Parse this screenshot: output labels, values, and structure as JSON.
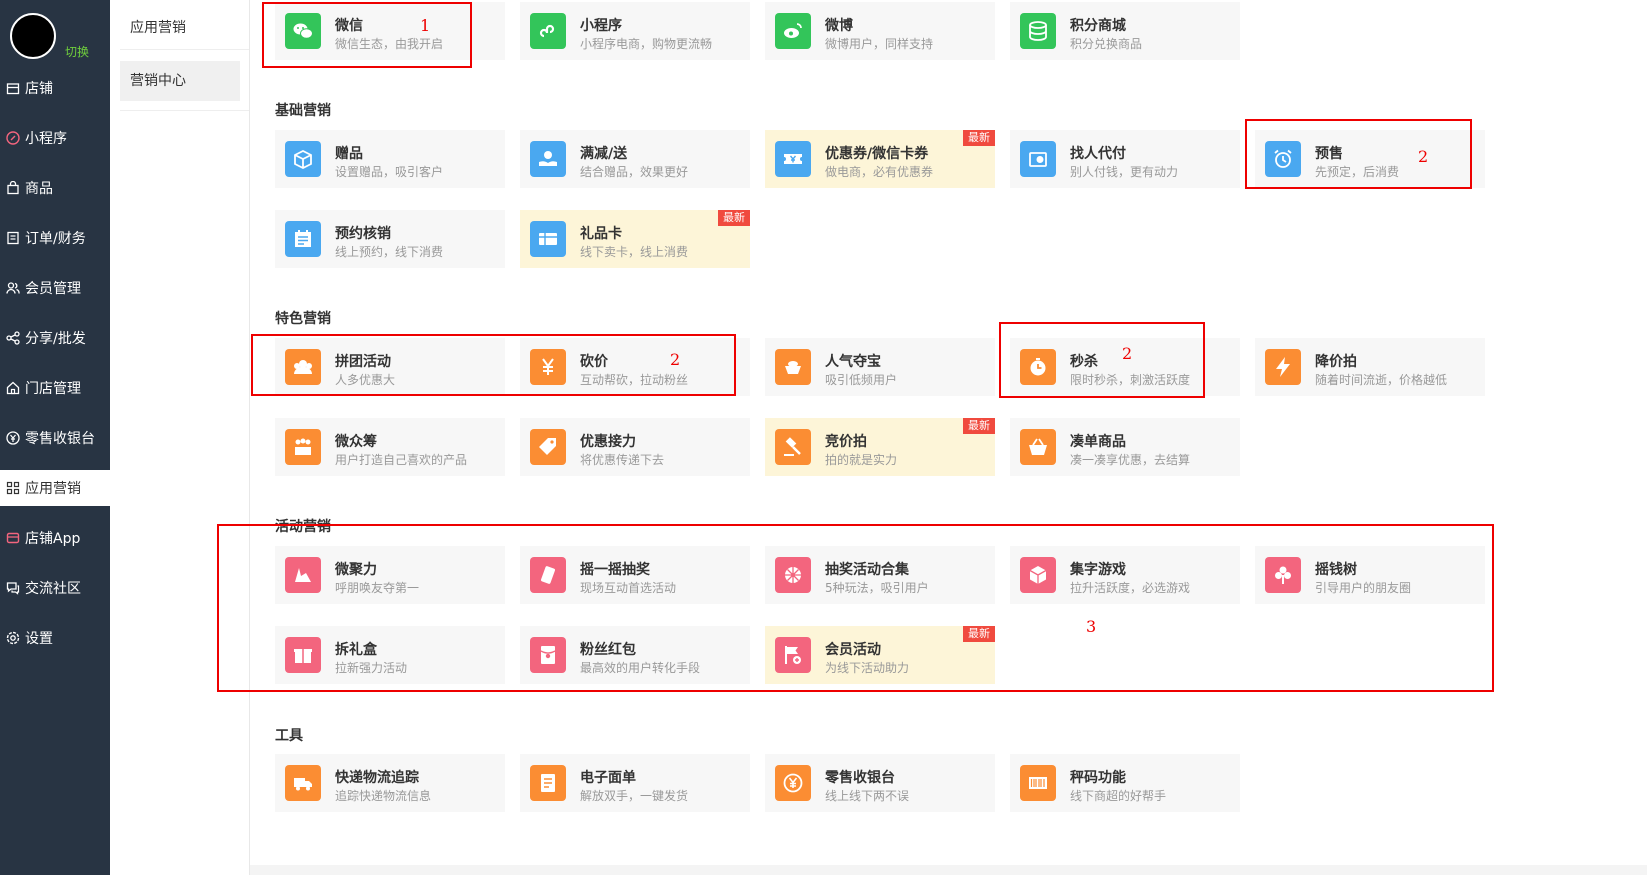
{
  "sidebar": {
    "switch_label": "切换",
    "items": [
      {
        "label": "店铺",
        "icon": "store-icon"
      },
      {
        "label": "小程序",
        "icon": "mini-program-icon"
      },
      {
        "label": "商品",
        "icon": "goods-bag-icon"
      },
      {
        "label": "订单/财务",
        "icon": "order-icon"
      },
      {
        "label": "会员管理",
        "icon": "member-icon"
      },
      {
        "label": "分享/批发",
        "icon": "share-icon"
      },
      {
        "label": "门店管理",
        "icon": "shop-home-icon"
      },
      {
        "label": "零售收银台",
        "icon": "cashier-icon"
      },
      {
        "label": "应用营销",
        "icon": "apps-grid-icon"
      },
      {
        "label": "店铺App",
        "icon": "app-icon"
      },
      {
        "label": "交流社区",
        "icon": "community-icon"
      },
      {
        "label": "设置",
        "icon": "settings-icon"
      }
    ]
  },
  "subnav": {
    "title": "应用营销",
    "items": [
      {
        "label": "营销中心"
      }
    ]
  },
  "sections": [
    {
      "title": "",
      "cards": [
        {
          "title": "微信",
          "desc": "微信生态，由我开启",
          "icon": "wechat-icon",
          "badge": ""
        },
        {
          "title": "小程序",
          "desc": "小程序电商，购物更流畅",
          "icon": "mini-program-icon",
          "badge": ""
        },
        {
          "title": "微博",
          "desc": "微博用户，同样支持",
          "icon": "weibo-icon",
          "badge": ""
        },
        {
          "title": "积分商城",
          "desc": "积分兑换商品",
          "icon": "points-mall-icon",
          "badge": ""
        }
      ]
    },
    {
      "title": "基础营销",
      "cards": [
        {
          "title": "赠品",
          "desc": "设置赠品，吸引客户",
          "icon": "gift-box-icon",
          "badge": ""
        },
        {
          "title": "满减/送",
          "desc": "结合赠品，效果更好",
          "icon": "discount-hand-icon",
          "badge": ""
        },
        {
          "title": "优惠券/微信卡券",
          "desc": "做电商，必有优惠券",
          "icon": "coupon-icon",
          "badge": "最新"
        },
        {
          "title": "找人代付",
          "desc": "别人付钱，更有动力",
          "icon": "pay-for-me-icon",
          "badge": ""
        },
        {
          "title": "预售",
          "desc": "先预定，后消费",
          "icon": "alarm-clock-icon",
          "badge": ""
        },
        {
          "title": "预约核销",
          "desc": "线上预约，线下消费",
          "icon": "calendar-icon",
          "badge": ""
        },
        {
          "title": "礼品卡",
          "desc": "线下卖卡，线上消费",
          "icon": "gift-card-icon",
          "badge": "最新"
        }
      ]
    },
    {
      "title": "特色营销",
      "cards": [
        {
          "title": "拼团活动",
          "desc": "人多优惠大",
          "icon": "group-buy-icon",
          "badge": ""
        },
        {
          "title": "砍价",
          "desc": "互动帮砍，拉动粉丝",
          "icon": "bargain-icon",
          "badge": ""
        },
        {
          "title": "人气夺宝",
          "desc": "吸引低频用户",
          "icon": "treasure-icon",
          "badge": ""
        },
        {
          "title": "秒杀",
          "desc": "限时秒杀，刺激活跃度",
          "icon": "timer-icon",
          "badge": ""
        },
        {
          "title": "降价拍",
          "desc": "随着时间流逝，价格越低",
          "icon": "lightning-icon",
          "badge": ""
        },
        {
          "title": "微众筹",
          "desc": "用户打造自己喜欢的产品",
          "icon": "crowdfunding-icon",
          "badge": ""
        },
        {
          "title": "优惠接力",
          "desc": "将优惠传递下去",
          "icon": "tag-icon",
          "badge": ""
        },
        {
          "title": "竞价拍",
          "desc": "拍的就是实力",
          "icon": "auction-hammer-icon",
          "badge": "最新"
        },
        {
          "title": "凑单商品",
          "desc": "凑一凑享优惠，去结算",
          "icon": "basket-icon",
          "badge": ""
        }
      ]
    },
    {
      "title": "活动营销",
      "cards": [
        {
          "title": "微聚力",
          "desc": "呼朋唤友夺第一",
          "icon": "gather-icon",
          "badge": ""
        },
        {
          "title": "摇一摇抽奖",
          "desc": "现场互动首选活动",
          "icon": "shake-phone-icon",
          "badge": ""
        },
        {
          "title": "抽奖活动合集",
          "desc": "5种玩法，吸引用户",
          "icon": "lottery-wheel-icon",
          "badge": ""
        },
        {
          "title": "集字游戏",
          "desc": "拉升活跃度，必选游戏",
          "icon": "cube-icon",
          "badge": ""
        },
        {
          "title": "摇钱树",
          "desc": "引导用户的朋友圈",
          "icon": "money-tree-icon",
          "badge": ""
        },
        {
          "title": "拆礼盒",
          "desc": "拉新强力活动",
          "icon": "gift-open-icon",
          "badge": ""
        },
        {
          "title": "粉丝红包",
          "desc": "最高效的用户转化手段",
          "icon": "red-envelope-icon",
          "badge": ""
        },
        {
          "title": "会员活动",
          "desc": "为线下活动助力",
          "icon": "flag-plus-icon",
          "badge": "最新"
        }
      ]
    },
    {
      "title": "工具",
      "cards": [
        {
          "title": "快递物流追踪",
          "desc": "追踪快递物流信息",
          "icon": "truck-icon",
          "badge": ""
        },
        {
          "title": "电子面单",
          "desc": "解放双手，一键发货",
          "icon": "document-icon",
          "badge": ""
        },
        {
          "title": "零售收银台",
          "desc": "线上线下两不误",
          "icon": "yuan-icon",
          "badge": ""
        },
        {
          "title": "秤码功能",
          "desc": "线下商超的好帮手",
          "icon": "barcode-icon",
          "badge": ""
        }
      ]
    }
  ],
  "annotations": [
    "1",
    "2",
    "2",
    "2",
    "3"
  ],
  "colors": {
    "sidebar": "#283443",
    "green": "#33c55a",
    "blue": "#4aa8f0",
    "orange": "#fb8d33",
    "pink": "#f3657e",
    "badge": "#f04a3e",
    "highlight": "#fdf5d8",
    "annotation": "#e00000"
  }
}
